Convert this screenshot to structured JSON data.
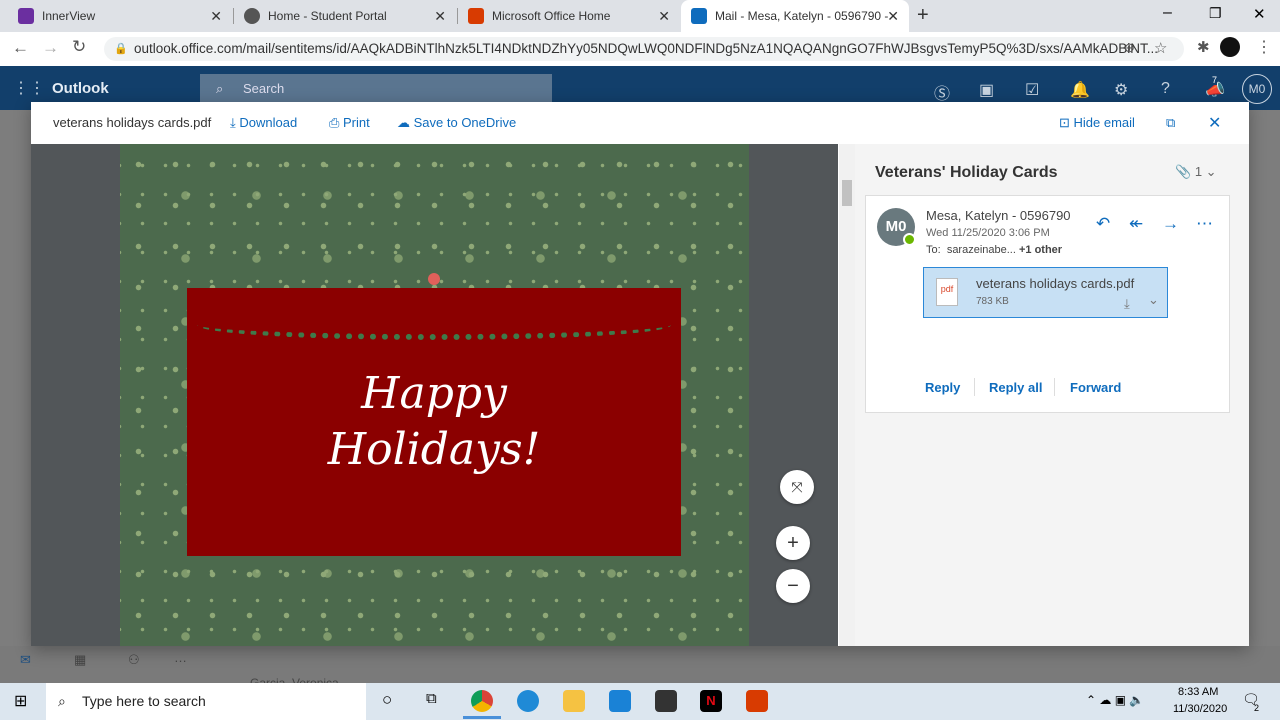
{
  "browser": {
    "tabs": [
      {
        "label": "InnerView"
      },
      {
        "label": "Home - Student Portal"
      },
      {
        "label": "Microsoft Office Home"
      },
      {
        "label": "Mail - Mesa, Katelyn - 0596790 -"
      }
    ],
    "url": "outlook.office.com/mail/sentitems/id/AAQkADBiNTlhNzk5LTI4NDktNDZhYy05NDQwLWQ0NDFlNDg5NzA1NQAQANgnGO7FhWJBsgvsTemyP5Q%3D/sxs/AAMkADBiNT..."
  },
  "outlook": {
    "app_name": "Outlook",
    "search_placeholder": "Search",
    "notif_count": "7",
    "user_initials": "M0"
  },
  "viewer": {
    "file_name": "veterans holidays cards.pdf",
    "download": "Download",
    "print": "Print",
    "save": "Save to OneDrive",
    "hide_email": "Hide email",
    "card_line1": "Happy",
    "card_line2": "Holidays!"
  },
  "email": {
    "subject": "Veterans' Holiday Cards",
    "attachment_count": "1",
    "sender": "Mesa, Katelyn - 0596790",
    "initials": "M0",
    "date": "Wed 11/25/2020 3:06 PM",
    "to_label": "To:",
    "to": "sarazeinabe...",
    "to_more": "+1 other",
    "attachment": {
      "name": "veterans holidays cards.pdf",
      "size": "783 KB",
      "icon": "pdf"
    },
    "reply": "Reply",
    "reply_all": "Reply all",
    "forward": "Forward"
  },
  "background": {
    "list_name": "Garcia, Veronica"
  },
  "taskbar": {
    "search_placeholder": "Type here to search",
    "time": "8:33 AM",
    "date": "11/30/2020",
    "notifications": "2"
  }
}
